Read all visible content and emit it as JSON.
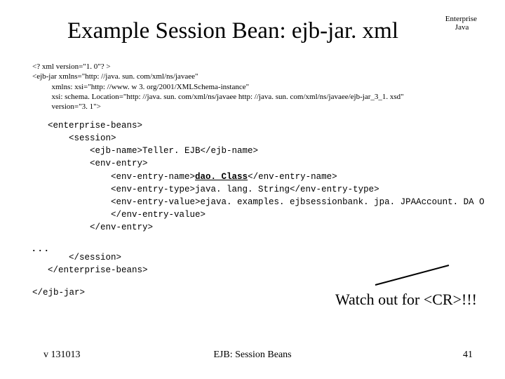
{
  "title": "Example Session Bean: ejb-jar. xml",
  "logo": {
    "line1": "Enterprise",
    "line2": "Java"
  },
  "header": "<? xml version=\"1. 0\"? >\n<ejb-jar xmlns=\"http: //java. sun. com/xml/ns/javaee\"\n          xmlns: xsi=\"http: //www. w 3. org/2001/XMLSchema-instance\"\n          xsi: schema. Location=\"http: //java. sun. com/xml/ns/javaee http: //java. sun. com/xml/ns/javaee/ejb-jar_3_1. xsd\"\n          version=\"3. 1\">",
  "code1a": "<enterprise-beans>\n    <session>\n        <ejb-name>Teller. EJB</ejb-name>\n        <env-entry>\n            <env-entry-name>",
  "daoClass": "dao. Class",
  "code1b": "</env-entry-name>\n            <env-entry-type>java. lang. String</env-entry-type>\n            <env-entry-value>ejava. examples. ejbsessionbank. jpa. JPAAccount. DA O\n            </env-entry-value>\n        </env-entry>",
  "ellipsis": ". . .",
  "code2": "    </session>\n</enterprise-beans>",
  "code3": "</ejb-jar>",
  "watchout": "Watch out for <CR>!!!",
  "footer": {
    "left": "v 131013",
    "center": "EJB: Session Beans",
    "right": "41"
  }
}
